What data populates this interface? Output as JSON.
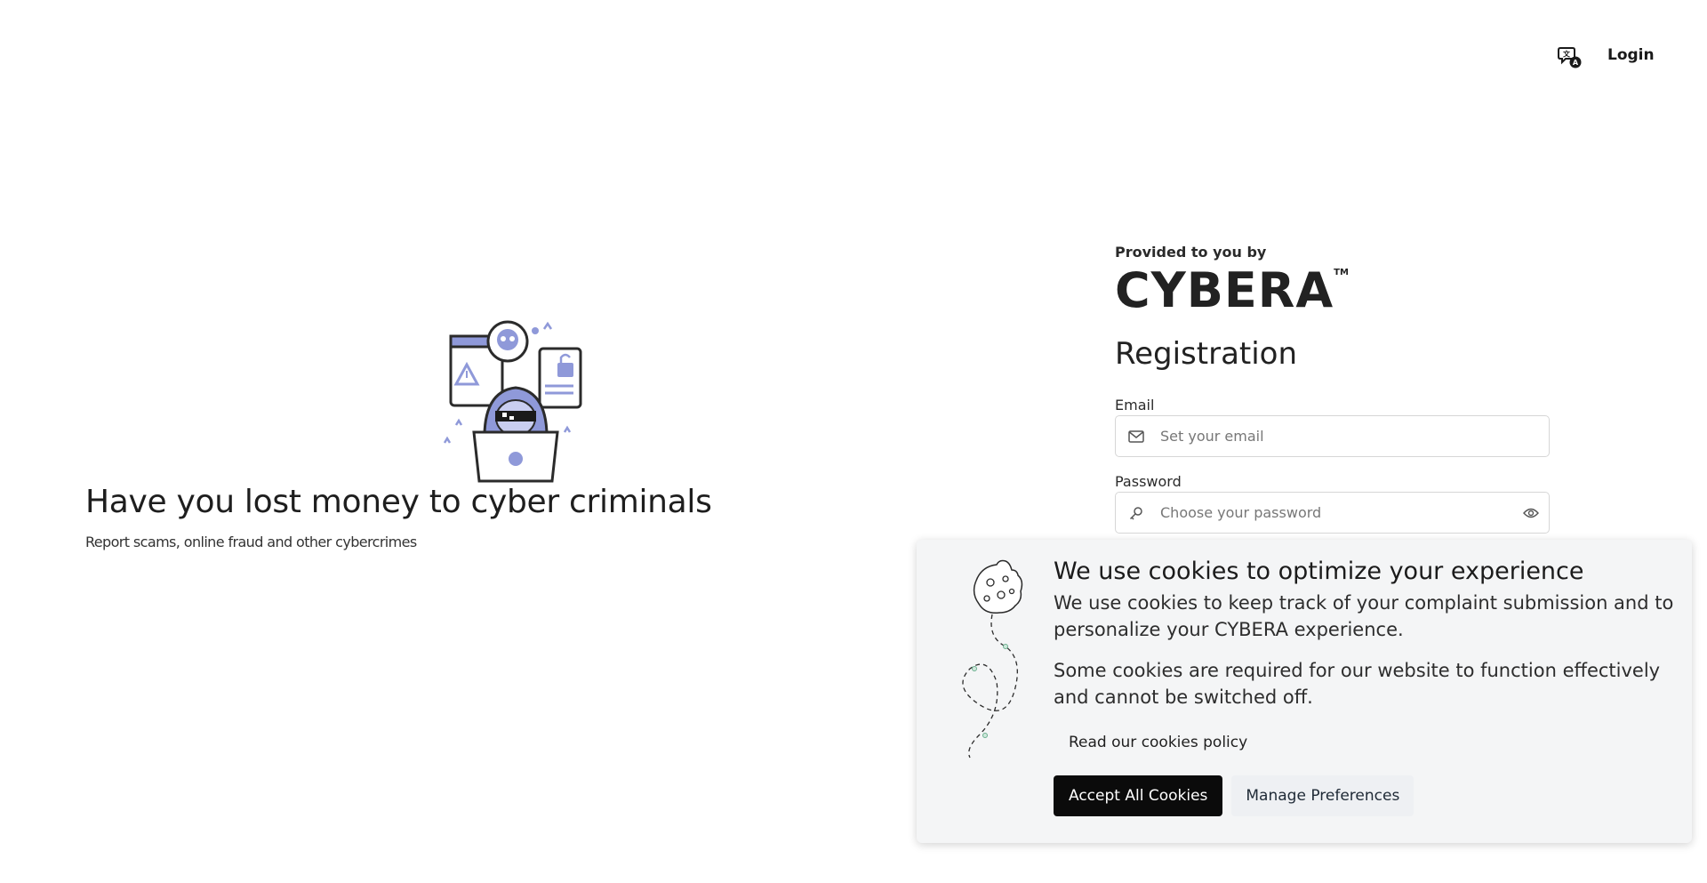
{
  "header": {
    "language_icon": "translate-icon",
    "login_label": "Login"
  },
  "hero": {
    "illustration": "hacker-laptop-illustration",
    "title": "Have you lost money to cyber criminals",
    "subtitle": "Report scams, online fraud and other cybercrimes"
  },
  "registration": {
    "provided_by": "Provided to you by",
    "brand": "CYBERA",
    "brand_tm": "TM",
    "title": "Registration",
    "email": {
      "label": "Email",
      "placeholder": "Set your email",
      "value": "",
      "icon": "envelope-icon"
    },
    "password": {
      "label": "Password",
      "placeholder": "Choose your password",
      "value": "",
      "icon": "key-icon",
      "toggle_icon": "eye-icon"
    }
  },
  "cookie_banner": {
    "art": "cookie-trail-illustration",
    "title": "We use cookies to optimize your experience",
    "text1": "We use cookies to keep track of your complaint submission and to personalize your CYBERA experience.",
    "text2": "Some cookies are required for our website to function effectively and cannot be switched off.",
    "policy_link": "Read our cookies policy",
    "accept_label": "Accept All Cookies",
    "manage_label": "Manage Preferences"
  },
  "colors": {
    "illustration_accent": "#8f99d9",
    "accept_button": "#0b0b0b",
    "banner_bg": "#f4f5f6"
  }
}
